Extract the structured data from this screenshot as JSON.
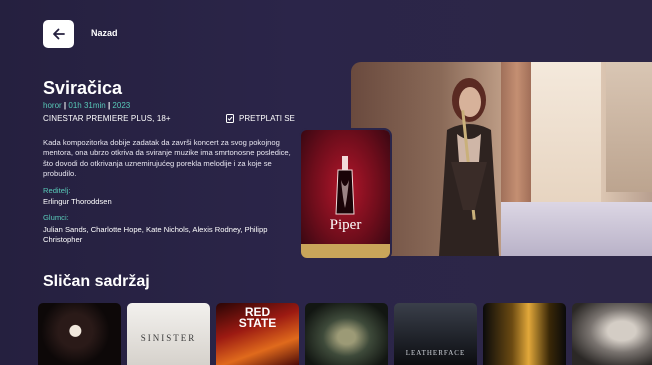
{
  "header": {
    "back_label": "Nazad"
  },
  "movie": {
    "title": "Sviračica",
    "genre": "horor",
    "duration": "01h 31min",
    "year": "2023",
    "channel": "CINESTAR PREMIERE PLUS, 18+",
    "subscribe_label": "PRETPLATI SE",
    "description": "Kada kompozitorka dobije zadatak da završi koncert za svog pokojnog mentora, ona ubrzo otkriva da sviranje muzike ima smrtonosne posledice, što dovodi do otkrivanja uznemirujućeg porekla melodije i za koje se probudilo.",
    "director_label": "Reditelj:",
    "director": "Erlingur Thoroddsen",
    "cast_label": "Glumci:",
    "cast": "Julian Sands, Charlotte Hope, Kate Nichols, Alexis Rodney, Philipp Christopher",
    "poster_title": "Piper"
  },
  "similar": {
    "title": "Sličan sadržaj",
    "items": [
      {
        "text": ""
      },
      {
        "text": "SINISTER"
      },
      {
        "text": "RED STATE"
      },
      {
        "text": ""
      },
      {
        "text": "LEATHERFACE"
      },
      {
        "text": ""
      },
      {
        "text": ""
      }
    ]
  },
  "colors": {
    "accent": "#58c9b8",
    "background": "#25203f"
  }
}
